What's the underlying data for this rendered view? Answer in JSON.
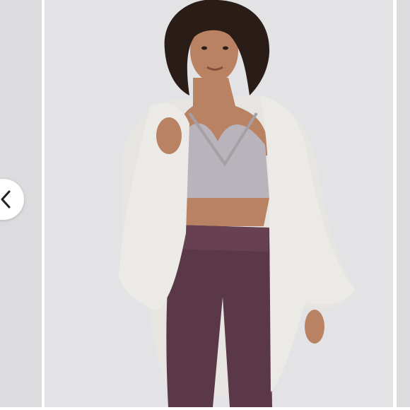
{
  "gallery": {
    "prev_button_icon": "chevron-left-icon",
    "photo_icon": "product-photo",
    "colors": {
      "backdrop": "#e3e3e6",
      "side_slides": "#dcdcdf",
      "cardigan": "#e6e5e1",
      "bra": "#b9b4bb",
      "leggings": "#5b3848",
      "skin": "#b98363",
      "hair": "#2a1d17"
    }
  }
}
